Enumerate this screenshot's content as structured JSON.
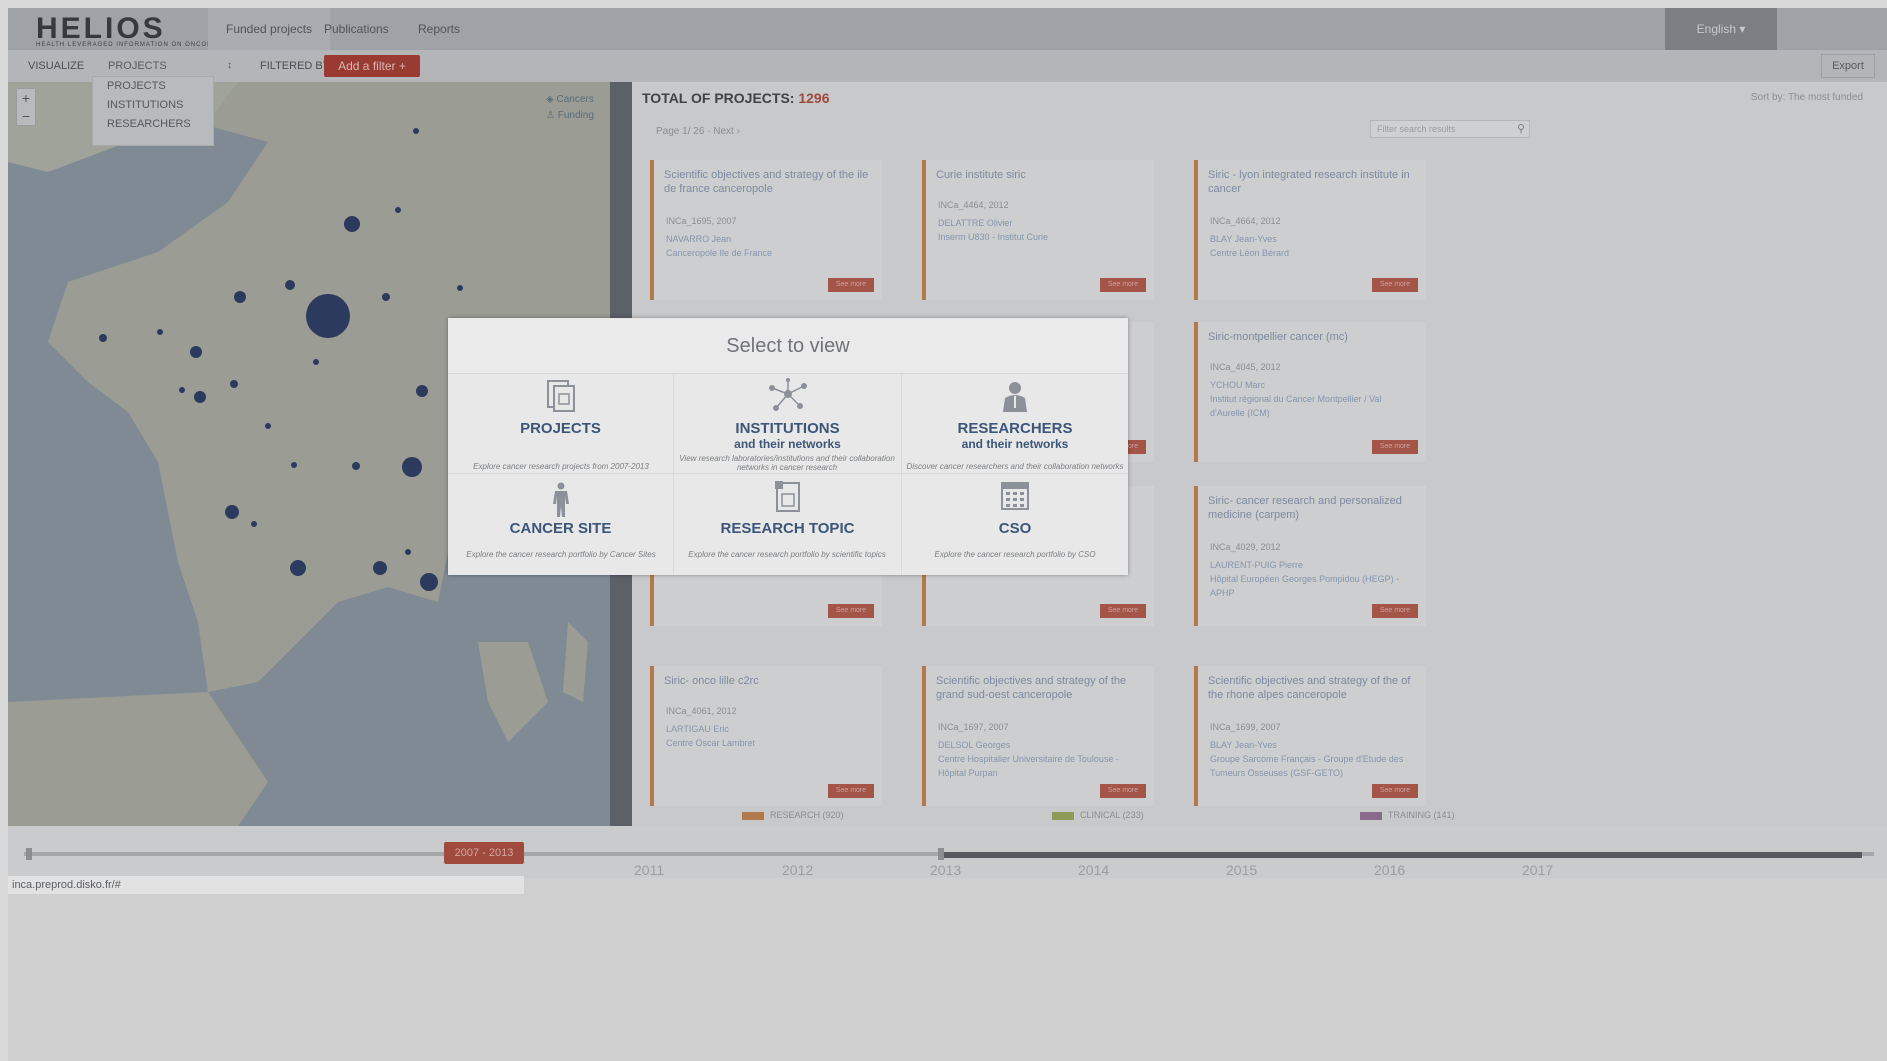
{
  "nav": {
    "logo": "HELIOS",
    "logo_tagline": "HEALTH LEVERAGED INFORMATION ON ONCOLOGY",
    "tabs": [
      "Funded projects",
      "Publications",
      "Reports"
    ],
    "language": "English"
  },
  "toolbar": {
    "visualize_label": "VISUALIZE",
    "visualize_value": "PROJECTS",
    "filtered_by_label": "FILTERED BY",
    "add_filter_label": "Add a filter",
    "export_label": "Export",
    "dropdown_options": [
      "PROJECTS",
      "INSTITUTIONS",
      "RESEARCHERS"
    ]
  },
  "map": {
    "legend_items": [
      "Cancers",
      "Funding"
    ]
  },
  "panel": {
    "total_label": "TOTAL OF PROJECTS:",
    "total_count": "1296",
    "sort_by": "Sort by: The most funded",
    "pager": "Page 1/ 26 ·  Next",
    "search_placeholder": "Filter search results",
    "more_label": "See more",
    "cards": [
      {
        "title": "Scientific objectives and strategy of the ile de france canceropole",
        "id": "INCa_1695, 2007",
        "person": "NAVARRO Jean",
        "org": "Canceropole Ile de France"
      },
      {
        "title": "Curie institute siric",
        "id": "INCa_4464, 2012",
        "person": "DELATTRE Olivier",
        "org": "Inserm U830 - Institut Curie"
      },
      {
        "title": "Siric - lyon integrated research institute in cancer",
        "id": "INCa_4664, 2012",
        "person": "BLAY Jean-Yves",
        "org": "Centre Léon Bérard"
      },
      {
        "title": "Siric-montpellier cancer (mc)",
        "id": "INCa_4045, 2012",
        "person": "YCHOU Marc",
        "org": "Institut régional du Cancer Montpellier / Val d'Aurelle (ICM)"
      },
      {
        "title": "Siric- cancer research and personalized medicine (carpem)",
        "id": "INCa_4029, 2012",
        "person": "LAURENT-PUIG Pierre",
        "org": "Hôpital Européen Georges Pompidou (HEGP) - APHP"
      },
      {
        "title": "Siric- onco lille c2rc",
        "id": "INCa_4061, 2012",
        "person": "LARTIGAU Eric",
        "org": "Centre Oscar Lambret"
      },
      {
        "title": "Scientific objectives and strategy of the grand sud-oest canceropole",
        "id": "INCa_1697, 2007",
        "person": "DELSOL Georges",
        "org": "Centre Hospitalier Universitaire de Toulouse - Hôpital Purpan"
      },
      {
        "title": "Scientific objectives and strategy of the of the rhone alpes canceropole",
        "id": "INCa_1699, 2007",
        "person": "BLAY Jean-Yves",
        "org": "Groupe Sarcome Français - Groupe d'Etude des Tumeurs Osseuses (GSF-GETO)"
      }
    ],
    "legend": [
      {
        "label": "RESEARCH (920)",
        "color": "#b07a4a"
      },
      {
        "label": "CLINICAL (233)",
        "color": "#8e9a58"
      },
      {
        "label": "TRAINING (141)",
        "color": "#8a6a8a"
      }
    ]
  },
  "timeline": {
    "range_label": "2007 - 2013",
    "years": [
      "2011",
      "2012",
      "2013",
      "2014",
      "2015",
      "2016",
      "2017"
    ]
  },
  "status_bar": "inca.preprod.disko.fr/#",
  "modal": {
    "title": "Select to view",
    "options": [
      {
        "label": "PROJECTS",
        "sub": "",
        "desc": "Explore cancer research projects from 2007-2013",
        "icon": "document-icon"
      },
      {
        "label": "INSTITUTIONS",
        "sub": "and their networks",
        "desc": "View research laboratories/institutions and their collaboration networks in cancer research",
        "icon": "network-icon"
      },
      {
        "label": "RESEARCHERS",
        "sub": "and their networks",
        "desc": "Discover cancer researchers and their collaboration networks",
        "icon": "person-icon"
      },
      {
        "label": "CANCER SITE",
        "sub": "",
        "desc": "Explore the cancer research portfolio by Cancer Sites",
        "icon": "body-icon"
      },
      {
        "label": "RESEARCH TOPIC",
        "sub": "",
        "desc": "Explore the cancer research portfolio by scientific topics",
        "icon": "topic-document-icon"
      },
      {
        "label": "CSO",
        "sub": "",
        "desc": "Explore the cancer research portfolio by CSO",
        "icon": "calendar-grid-icon"
      }
    ]
  }
}
